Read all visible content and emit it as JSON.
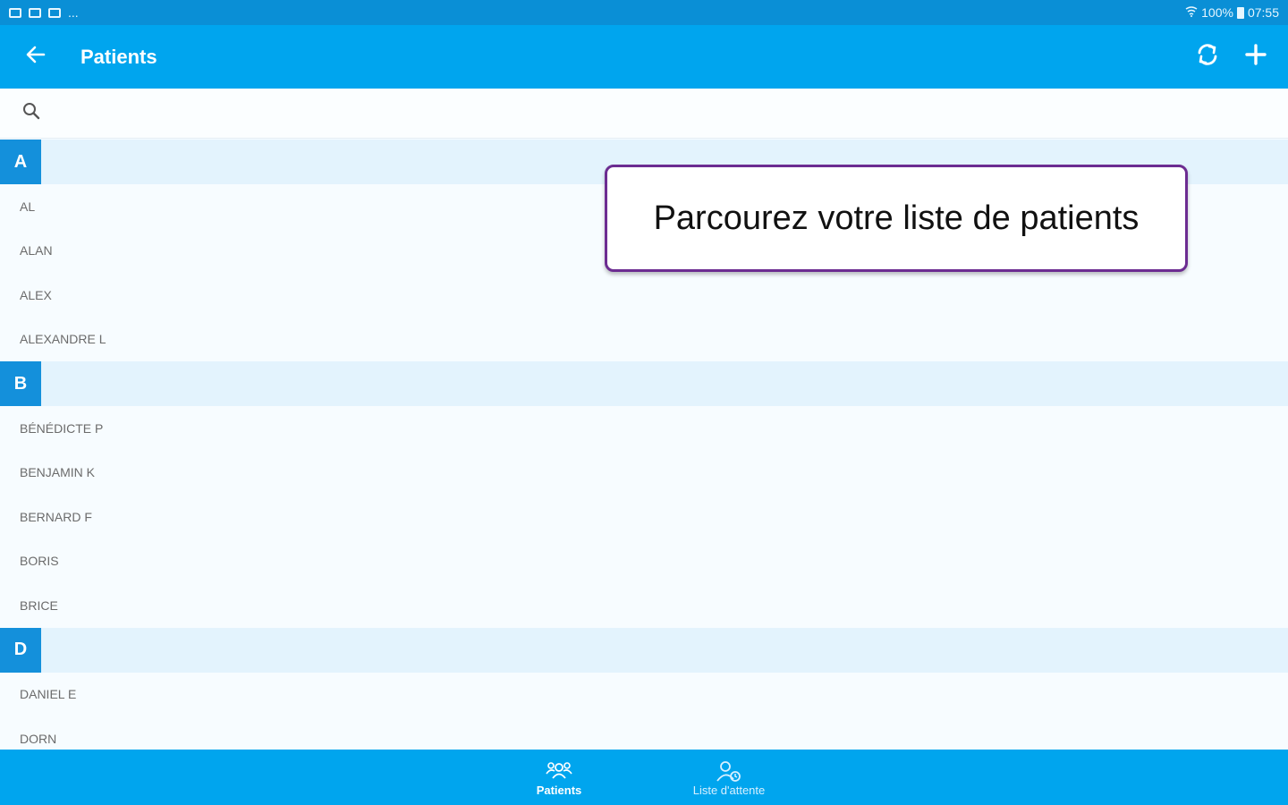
{
  "statusbar": {
    "more": "...",
    "battery": "100%",
    "time": "07:55"
  },
  "appbar": {
    "title": "Patients",
    "back_icon": "arrow-left-icon",
    "sync_icon": "sync-icon",
    "add_icon": "plus-icon"
  },
  "search": {
    "placeholder": "",
    "value": ""
  },
  "sections": [
    {
      "letter": "A",
      "items": [
        "AL",
        "ALAN",
        "ALEX",
        "ALEXANDRE L"
      ]
    },
    {
      "letter": "B",
      "items": [
        "BÉNÉDICTE P",
        "BENJAMIN K",
        "BERNARD F",
        "BORIS",
        "BRICE"
      ]
    },
    {
      "letter": "D",
      "items": [
        "DANIEL E",
        "DORN"
      ]
    }
  ],
  "tooltip": {
    "text": "Parcourez votre liste de patients"
  },
  "bottomnav": {
    "patients_label": "Patients",
    "waitlist_label": "Liste d'attente"
  },
  "colors": {
    "primary": "#00a5ee",
    "section_letter": "#1490db",
    "section_bg": "#e3f3fd",
    "tooltip_border": "#6c2c91"
  }
}
